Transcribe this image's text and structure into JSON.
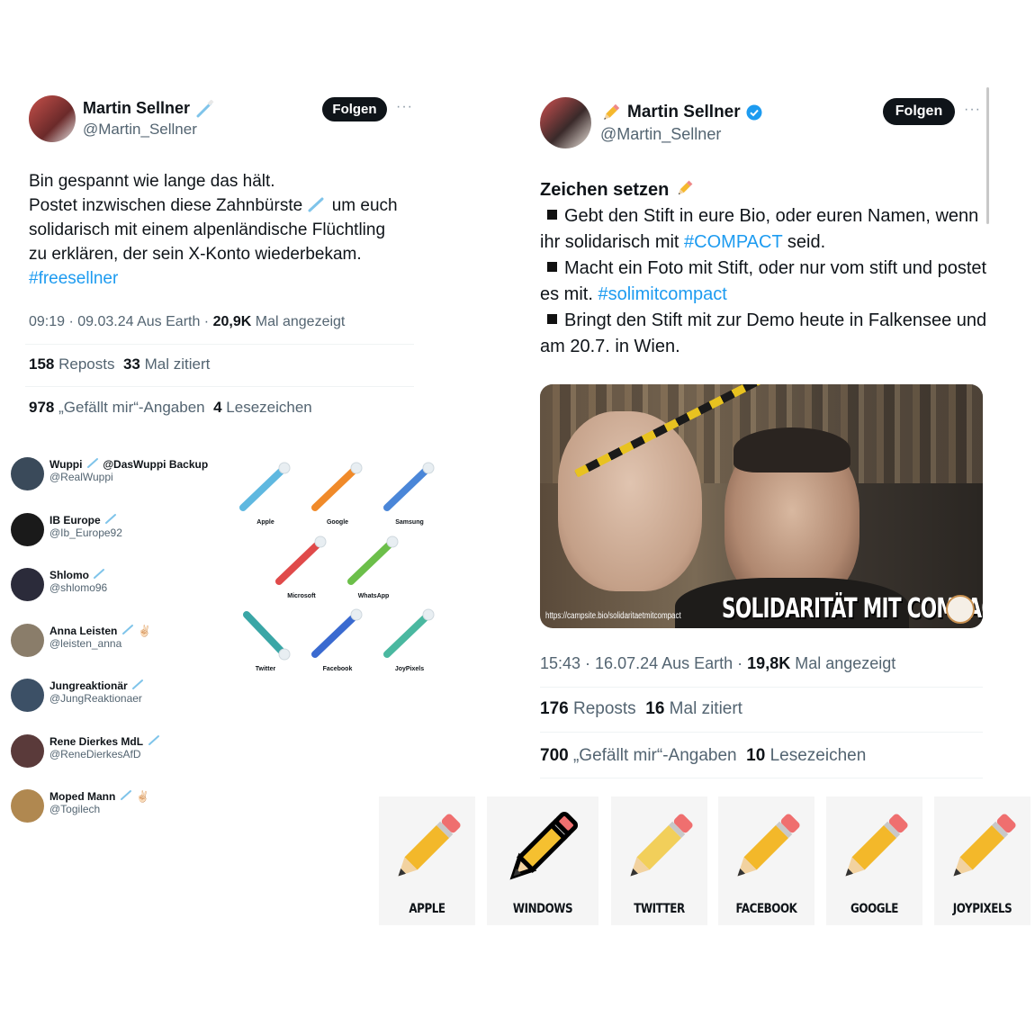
{
  "tweet1": {
    "name": "Martin Sellner",
    "name_icon": "toothbrush-icon",
    "handle": "@Martin_Sellner",
    "follow_label": "Folgen",
    "more": "···",
    "text_lines": [
      "Bin gespannt wie lange das hält.",
      "Postet inzwischen diese Zahnbürste",
      "um euch",
      "solidarisch mit einem alpenländische Flüchtling",
      "zu erklären, der sein X-Konto wiederbekam."
    ],
    "hashtag": "#freesellner",
    "meta_time": "09:19 · 09.03.24 Aus Earth ·",
    "views_count": "20,9K",
    "views_label": "Mal angezeigt",
    "reposts_count": "158",
    "reposts_label": "Reposts",
    "quotes_count": "33",
    "quotes_label": "Mal zitiert",
    "likes_count": "978",
    "likes_label": "„Gefällt mir“-Angaben",
    "bookmarks_count": "4",
    "bookmarks_label": "Lesezeichen"
  },
  "followers": [
    {
      "name": "Wuppi",
      "extra": "@DasWuppi Backup",
      "handle": "@RealWuppi",
      "avatar_color": "#3a4a5a",
      "emoji": ""
    },
    {
      "name": "IB Europe",
      "extra": "",
      "handle": "@Ib_Europe92",
      "avatar_color": "#1a1a1a",
      "emoji": ""
    },
    {
      "name": "Shlomo",
      "extra": "",
      "handle": "@shlomo96",
      "avatar_color": "#2b2b3a",
      "emoji": ""
    },
    {
      "name": "Anna Leisten",
      "extra": "",
      "handle": "@leisten_anna",
      "avatar_color": "#8a7d6a",
      "emoji": "✌🏻"
    },
    {
      "name": "Jungreaktionär",
      "extra": "",
      "handle": "@JungReaktionaer",
      "avatar_color": "#3c5066",
      "emoji": ""
    },
    {
      "name": "Rene Dierkes MdL",
      "extra": "",
      "handle": "@ReneDierkesAfD",
      "avatar_color": "#5a3a3a",
      "emoji": ""
    },
    {
      "name": "Moped Mann",
      "extra": "",
      "handle": "@Togilech",
      "avatar_color": "#b08850",
      "emoji": "✌🏻"
    }
  ],
  "toothbrushes": [
    {
      "label": "Apple",
      "color": "#5fb8e0"
    },
    {
      "label": "Google",
      "color": "#f08a2a"
    },
    {
      "label": "Samsung",
      "color": "#4a86d8"
    },
    {
      "label": "Microsoft",
      "color": "#e04a4a"
    },
    {
      "label": "WhatsApp",
      "color": "#6cbf4a"
    },
    {
      "label": "Twitter",
      "color": "#3aa6a6"
    },
    {
      "label": "Facebook",
      "color": "#3a6ad0"
    },
    {
      "label": "JoyPixels",
      "color": "#4ab8a0"
    }
  ],
  "tweet2": {
    "name": "Martin Sellner",
    "name_icon": "pencil-icon",
    "verified_icon": "verified-badge-icon",
    "handle": "@Martin_Sellner",
    "follow_label": "Folgen",
    "more": "···",
    "heading": "Zeichen setzen",
    "bullets": [
      {
        "before": "Gebt den Stift in eure Bio, oder euren Namen, wenn ihr solidarisch mit ",
        "tag": "#COMPACT",
        "after": " seid."
      },
      {
        "before": "Macht ein Foto mit Stift, oder nur vom stift und postet es mit. ",
        "tag": "#solimitcompact",
        "after": ""
      },
      {
        "before": "Bringt den Stift mit zur Demo heute in Falkensee und am 20.7. in Wien.",
        "tag": "",
        "after": ""
      }
    ],
    "image_url_text": "https://campsite.bio/solidaritaetmitcompact",
    "image_banner": "SOLIDARITÄT MIT COMPACT",
    "meta_time": "15:43 · 16.07.24 Aus Earth ·",
    "views_count": "19,8K",
    "views_label": "Mal angezeigt",
    "reposts_count": "176",
    "reposts_label": "Reposts",
    "quotes_count": "16",
    "quotes_label": "Mal zitiert",
    "likes_count": "700",
    "likes_label": "„Gefällt mir“-Angaben",
    "bookmarks_count": "10",
    "bookmarks_label": "Lesezeichen"
  },
  "pencils": [
    {
      "label": "APPLE",
      "style": "apple"
    },
    {
      "label": "WINDOWS",
      "style": "windows"
    },
    {
      "label": "TWITTER",
      "style": "twitter"
    },
    {
      "label": "FACEBOOK",
      "style": "facebook"
    },
    {
      "label": "GOOGLE",
      "style": "google"
    },
    {
      "label": "JOYPIXELS",
      "style": "joypixels"
    }
  ]
}
